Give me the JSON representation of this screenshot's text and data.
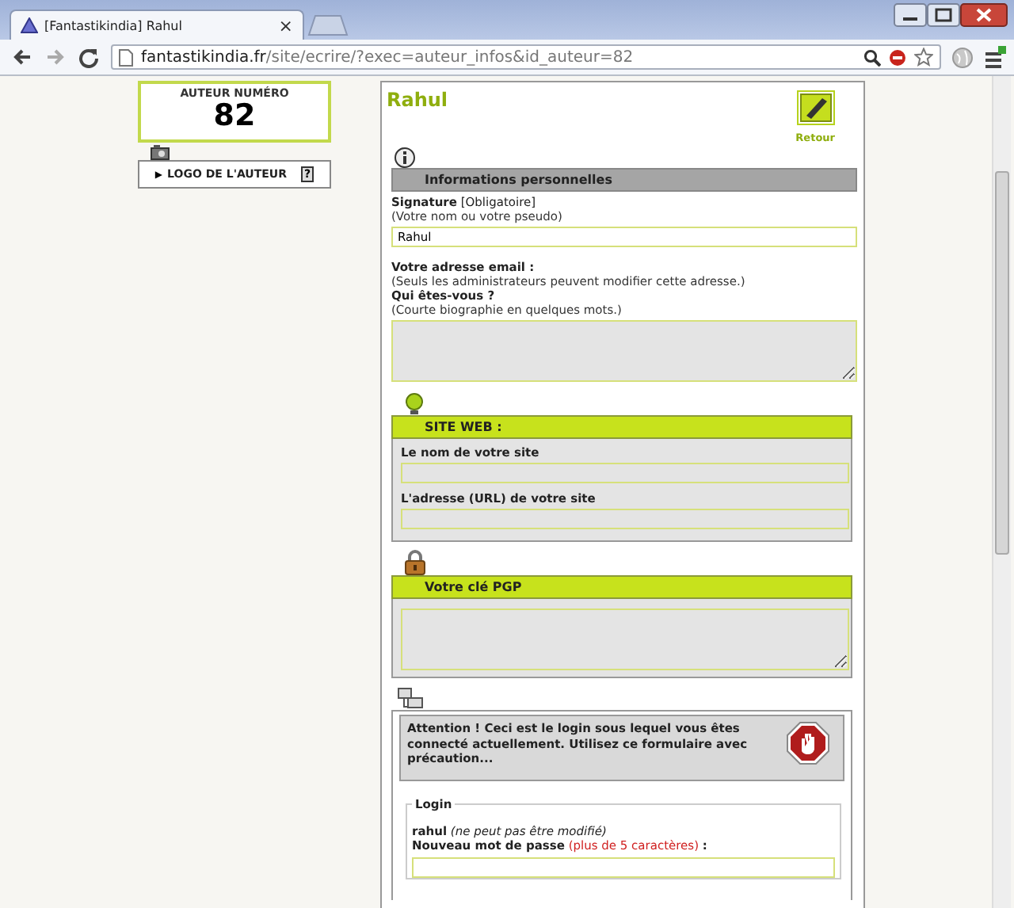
{
  "browser": {
    "tab_title": "[Fantastikindia] Rahul",
    "tab_close": "×",
    "url_host": "fantastikindia.fr",
    "url_path": "/site/ecrire/?exec=auteur_infos&id_auteur=82"
  },
  "author_box": {
    "label": "AUTEUR NUMÉRO",
    "number": "82"
  },
  "logo_toggle": {
    "arrow": "▶",
    "label": "LOGO DE L'AUTEUR",
    "help": "?"
  },
  "header": {
    "name": "Rahul",
    "back_label": "Retour"
  },
  "sections": [
    {
      "kind": "info",
      "title": "Informations personnelles",
      "fields": [
        {
          "kind": "input",
          "label": "**Signature** [Obligatoire]",
          "hint": "(Votre nom ou votre pseudo)",
          "value": "Rahul"
        },
        {
          "kind": "text",
          "label": "**Votre adresse email :**",
          "hint": "(Seuls les administrateurs peuvent modifier cette adresse.)"
        },
        {
          "kind": "textarea",
          "label": "**Qui êtes-vous ?**",
          "hint": "(Courte biographie en quelques mots.)"
        }
      ]
    },
    {
      "kind": "site",
      "title": "SITE WEB :",
      "fields": [
        {
          "kind": "input",
          "label": "Le nom de votre site"
        },
        {
          "kind": "input",
          "label": "L'adresse (URL) de votre site"
        }
      ]
    },
    {
      "kind": "pgp",
      "title": "Votre clé PGP",
      "fields": [
        {
          "kind": "textarea"
        }
      ]
    },
    {
      "kind": "login",
      "warning": "Attention ! Ceci est le login sous lequel vous êtes connecté actuellement. Utilisez ce formulaire avec précaution...",
      "legend": "Login",
      "login_line": "**rahul** *(ne peut pas être modifié)*",
      "password_label": "Nouveau mot de passe",
      "password_hint": "(plus de 5 caractères)",
      "password_suffix": ":"
    }
  ]
}
